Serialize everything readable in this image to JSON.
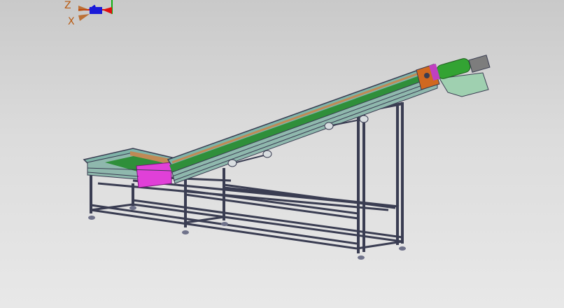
{
  "triad": {
    "z_label": "Z",
    "x_label": "X",
    "colors": {
      "x": "#e11010",
      "y": "#10b010",
      "z": "#1010e0",
      "label": "#b85a10"
    }
  },
  "model": {
    "icons": [
      "axis-triad-icon",
      "incline-belt-conveyor-model"
    ],
    "colors": {
      "frame": "#3a3d52",
      "frame_light": "#8a8fb0",
      "belt": "#2f8f3a",
      "side_rail": "#7fb3a8",
      "guide": "#c08a55",
      "plate": "#e040d8",
      "motor": "#33a333",
      "bracket": "#9fd0b0",
      "end_plate": "#d06820"
    }
  }
}
